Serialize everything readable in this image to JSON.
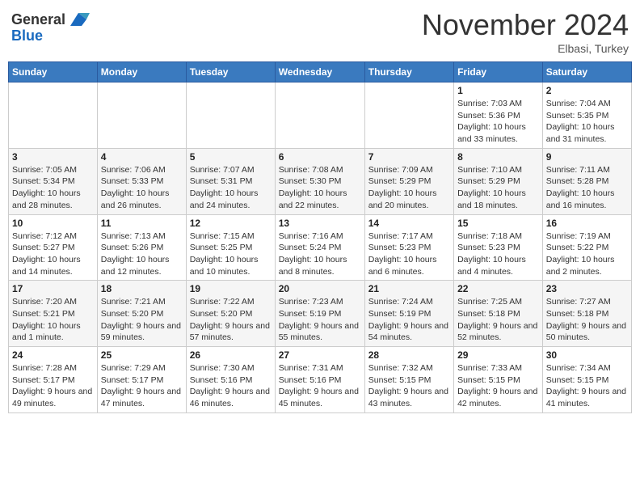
{
  "header": {
    "logo_line1": "General",
    "logo_line2": "Blue",
    "month": "November 2024",
    "location": "Elbasi, Turkey"
  },
  "weekdays": [
    "Sunday",
    "Monday",
    "Tuesday",
    "Wednesday",
    "Thursday",
    "Friday",
    "Saturday"
  ],
  "weeks": [
    [
      {
        "day": "",
        "info": ""
      },
      {
        "day": "",
        "info": ""
      },
      {
        "day": "",
        "info": ""
      },
      {
        "day": "",
        "info": ""
      },
      {
        "day": "",
        "info": ""
      },
      {
        "day": "1",
        "info": "Sunrise: 7:03 AM\nSunset: 5:36 PM\nDaylight: 10 hours and 33 minutes."
      },
      {
        "day": "2",
        "info": "Sunrise: 7:04 AM\nSunset: 5:35 PM\nDaylight: 10 hours and 31 minutes."
      }
    ],
    [
      {
        "day": "3",
        "info": "Sunrise: 7:05 AM\nSunset: 5:34 PM\nDaylight: 10 hours and 28 minutes."
      },
      {
        "day": "4",
        "info": "Sunrise: 7:06 AM\nSunset: 5:33 PM\nDaylight: 10 hours and 26 minutes."
      },
      {
        "day": "5",
        "info": "Sunrise: 7:07 AM\nSunset: 5:31 PM\nDaylight: 10 hours and 24 minutes."
      },
      {
        "day": "6",
        "info": "Sunrise: 7:08 AM\nSunset: 5:30 PM\nDaylight: 10 hours and 22 minutes."
      },
      {
        "day": "7",
        "info": "Sunrise: 7:09 AM\nSunset: 5:29 PM\nDaylight: 10 hours and 20 minutes."
      },
      {
        "day": "8",
        "info": "Sunrise: 7:10 AM\nSunset: 5:29 PM\nDaylight: 10 hours and 18 minutes."
      },
      {
        "day": "9",
        "info": "Sunrise: 7:11 AM\nSunset: 5:28 PM\nDaylight: 10 hours and 16 minutes."
      }
    ],
    [
      {
        "day": "10",
        "info": "Sunrise: 7:12 AM\nSunset: 5:27 PM\nDaylight: 10 hours and 14 minutes."
      },
      {
        "day": "11",
        "info": "Sunrise: 7:13 AM\nSunset: 5:26 PM\nDaylight: 10 hours and 12 minutes."
      },
      {
        "day": "12",
        "info": "Sunrise: 7:15 AM\nSunset: 5:25 PM\nDaylight: 10 hours and 10 minutes."
      },
      {
        "day": "13",
        "info": "Sunrise: 7:16 AM\nSunset: 5:24 PM\nDaylight: 10 hours and 8 minutes."
      },
      {
        "day": "14",
        "info": "Sunrise: 7:17 AM\nSunset: 5:23 PM\nDaylight: 10 hours and 6 minutes."
      },
      {
        "day": "15",
        "info": "Sunrise: 7:18 AM\nSunset: 5:23 PM\nDaylight: 10 hours and 4 minutes."
      },
      {
        "day": "16",
        "info": "Sunrise: 7:19 AM\nSunset: 5:22 PM\nDaylight: 10 hours and 2 minutes."
      }
    ],
    [
      {
        "day": "17",
        "info": "Sunrise: 7:20 AM\nSunset: 5:21 PM\nDaylight: 10 hours and 1 minute."
      },
      {
        "day": "18",
        "info": "Sunrise: 7:21 AM\nSunset: 5:20 PM\nDaylight: 9 hours and 59 minutes."
      },
      {
        "day": "19",
        "info": "Sunrise: 7:22 AM\nSunset: 5:20 PM\nDaylight: 9 hours and 57 minutes."
      },
      {
        "day": "20",
        "info": "Sunrise: 7:23 AM\nSunset: 5:19 PM\nDaylight: 9 hours and 55 minutes."
      },
      {
        "day": "21",
        "info": "Sunrise: 7:24 AM\nSunset: 5:19 PM\nDaylight: 9 hours and 54 minutes."
      },
      {
        "day": "22",
        "info": "Sunrise: 7:25 AM\nSunset: 5:18 PM\nDaylight: 9 hours and 52 minutes."
      },
      {
        "day": "23",
        "info": "Sunrise: 7:27 AM\nSunset: 5:18 PM\nDaylight: 9 hours and 50 minutes."
      }
    ],
    [
      {
        "day": "24",
        "info": "Sunrise: 7:28 AM\nSunset: 5:17 PM\nDaylight: 9 hours and 49 minutes."
      },
      {
        "day": "25",
        "info": "Sunrise: 7:29 AM\nSunset: 5:17 PM\nDaylight: 9 hours and 47 minutes."
      },
      {
        "day": "26",
        "info": "Sunrise: 7:30 AM\nSunset: 5:16 PM\nDaylight: 9 hours and 46 minutes."
      },
      {
        "day": "27",
        "info": "Sunrise: 7:31 AM\nSunset: 5:16 PM\nDaylight: 9 hours and 45 minutes."
      },
      {
        "day": "28",
        "info": "Sunrise: 7:32 AM\nSunset: 5:15 PM\nDaylight: 9 hours and 43 minutes."
      },
      {
        "day": "29",
        "info": "Sunrise: 7:33 AM\nSunset: 5:15 PM\nDaylight: 9 hours and 42 minutes."
      },
      {
        "day": "30",
        "info": "Sunrise: 7:34 AM\nSunset: 5:15 PM\nDaylight: 9 hours and 41 minutes."
      }
    ]
  ]
}
